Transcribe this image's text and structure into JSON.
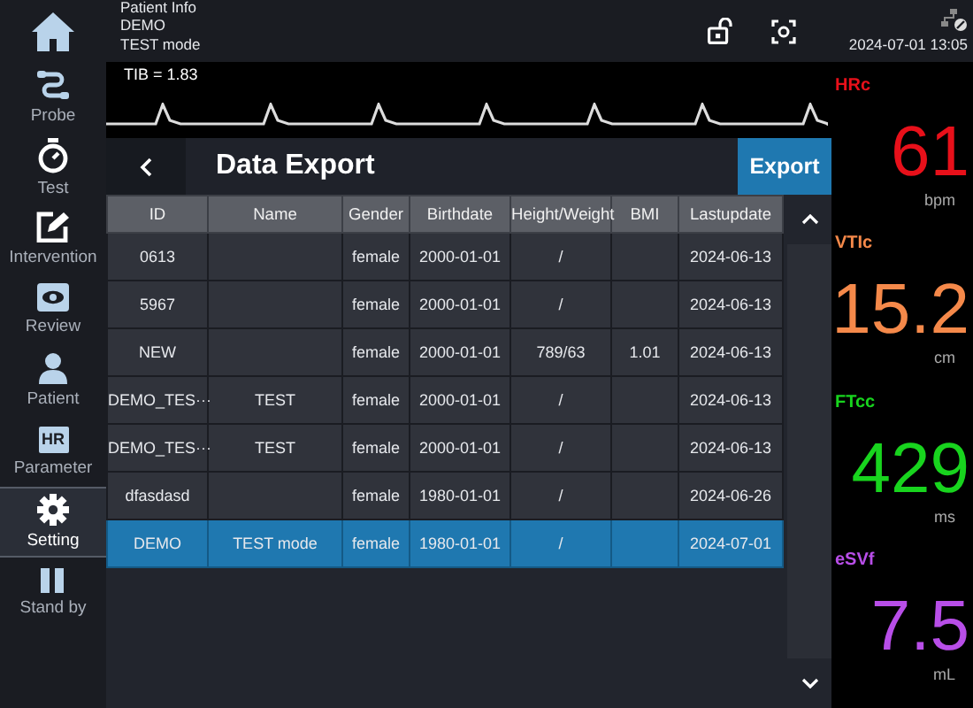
{
  "top_bar": {
    "patient_info": [
      "Patient Info",
      "DEMO",
      "TEST mode"
    ],
    "datetime": "2024-07-01 13:05"
  },
  "waveform": {
    "label": "TIB = 1.83"
  },
  "sidebar": {
    "items": [
      {
        "label": "Probe",
        "kind": "probe",
        "selected": false
      },
      {
        "label": "Test",
        "kind": "stopwatch",
        "selected": false
      },
      {
        "label": "Intervention",
        "kind": "pencil",
        "selected": false
      },
      {
        "label": "Review",
        "kind": "eye",
        "selected": false
      },
      {
        "label": "Patient",
        "kind": "person",
        "selected": false
      },
      {
        "label": "Parameter",
        "kind": "badge",
        "badge": "HR",
        "selected": false
      },
      {
        "label": "Setting",
        "kind": "gear",
        "selected": true
      },
      {
        "label": "Stand by",
        "kind": "pause",
        "selected": false
      }
    ]
  },
  "page": {
    "title": "Data Export",
    "export_button": "Export"
  },
  "table": {
    "columns": [
      "ID",
      "Name",
      "Gender",
      "Birthdate",
      "Height/Weight",
      "BMI",
      "Lastupdate"
    ],
    "rows": [
      {
        "cells": [
          "0613",
          "",
          "female",
          "2000-01-01",
          "/",
          "",
          "2024-06-13"
        ],
        "selected": false
      },
      {
        "cells": [
          "5967",
          "",
          "female",
          "2000-01-01",
          "/",
          "",
          "2024-06-13"
        ],
        "selected": false
      },
      {
        "cells": [
          "NEW",
          "",
          "female",
          "2000-01-01",
          "789/63",
          "1.01",
          "2024-06-13"
        ],
        "selected": false
      },
      {
        "cells": [
          "DEMO_TES···",
          "TEST",
          "female",
          "2000-01-01",
          "/",
          "",
          "2024-06-13"
        ],
        "selected": false
      },
      {
        "cells": [
          "DEMO_TES···",
          "TEST",
          "female",
          "2000-01-01",
          "/",
          "",
          "2024-06-13"
        ],
        "selected": false
      },
      {
        "cells": [
          "dfasdasd",
          "",
          "female",
          "1980-01-01",
          "/",
          "",
          "2024-06-26"
        ],
        "selected": false
      },
      {
        "cells": [
          "DEMO",
          "TEST mode",
          "female",
          "1980-01-01",
          "/",
          "",
          "2024-07-01"
        ],
        "selected": true
      }
    ]
  },
  "metrics": [
    {
      "label": "HRc",
      "value": "61",
      "unit": "bpm",
      "color": "#e8101a"
    },
    {
      "label": "VTIc",
      "value": "15.2",
      "unit": "cm",
      "color": "#f5894a"
    },
    {
      "label": "FTcc",
      "value": "429",
      "unit": "ms",
      "color": "#18d41e"
    },
    {
      "label": "eSVf",
      "value": "7.5",
      "unit": "mL",
      "color": "#b84ee8"
    }
  ]
}
